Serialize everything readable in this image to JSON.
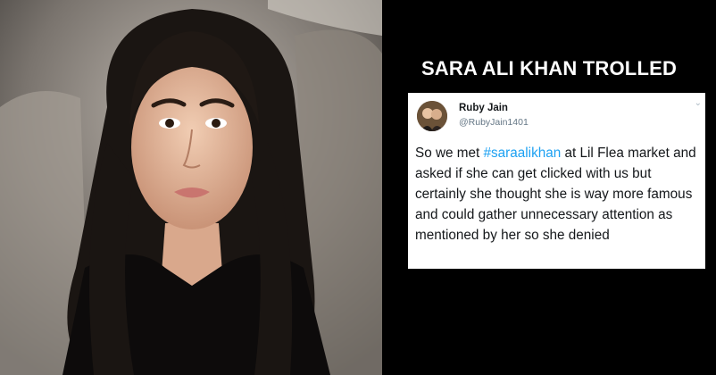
{
  "headline": "SARA ALI KHAN TROLLED",
  "tweet": {
    "name": "Ruby Jain",
    "handle": "@RubyJain1401",
    "text_before": "So we met ",
    "hashtag": "#saraalikhan",
    "text_after": " at Lil Flea market and asked if she can get clicked with us but certainly she thought she is way more famous and could gather unnecessary attention as mentioned by her so she denied",
    "hashtag_color": "#1da1f2",
    "menu_icon": "chevron-down-icon"
  },
  "photo": {
    "subject": "woman-portrait",
    "background_color": "#3a3a3a"
  }
}
